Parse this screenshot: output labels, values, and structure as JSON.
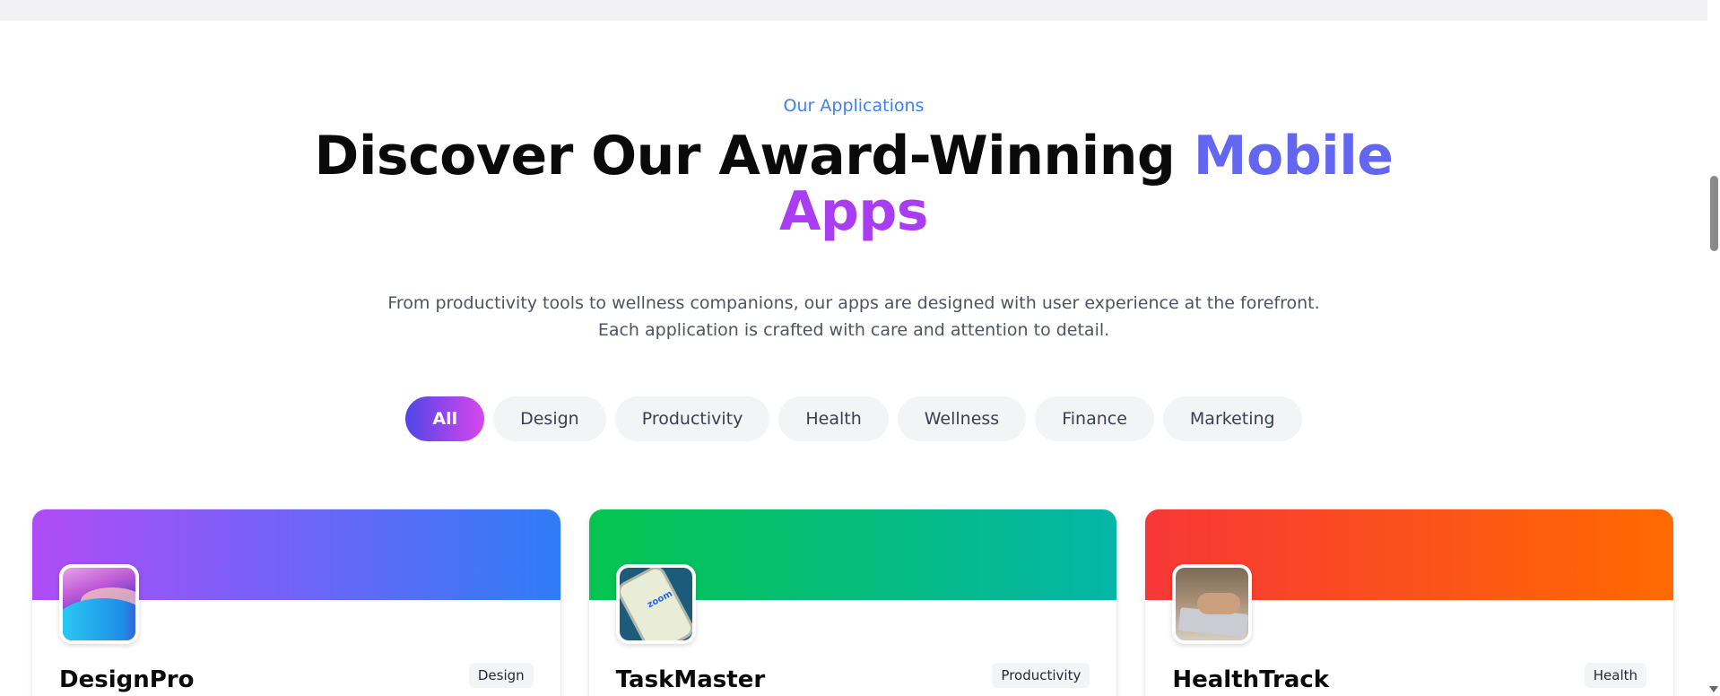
{
  "section": {
    "eyebrow": "Our Applications",
    "headline_main": "Discover Our Award-Winning ",
    "headline_accent_1": "Mobile",
    "headline_accent_2": "Apps",
    "subtitle_line_1": "From productivity tools to wellness companions, our apps are designed with user experience at the forefront.",
    "subtitle_line_2": "Each application is crafted with care and attention to detail."
  },
  "filters": {
    "active": "All",
    "items": [
      "All",
      "Design",
      "Productivity",
      "Health",
      "Wellness",
      "Finance",
      "Marketing"
    ]
  },
  "colors": {
    "eyebrow": "#3b82f6",
    "accent_mobile": "#6366f1",
    "accent_apps": "#a83df2",
    "chip_active_from": "#4f46e5",
    "chip_active_to": "#d946ef"
  },
  "apps": [
    {
      "name": "DesignPro",
      "category": "Design",
      "banner_from": "#b04cf7",
      "banner_to": "#2f7cf6",
      "icon": "abstract-wave-icon"
    },
    {
      "name": "TaskMaster",
      "category": "Productivity",
      "banner_from": "#06c44f",
      "banner_to": "#06b6a8",
      "icon": "phone-zoom-icon"
    },
    {
      "name": "HealthTrack",
      "category": "Health",
      "banner_from": "#f73737",
      "banner_to": "#ff6a00",
      "icon": "laptop-hands-icon"
    }
  ]
}
